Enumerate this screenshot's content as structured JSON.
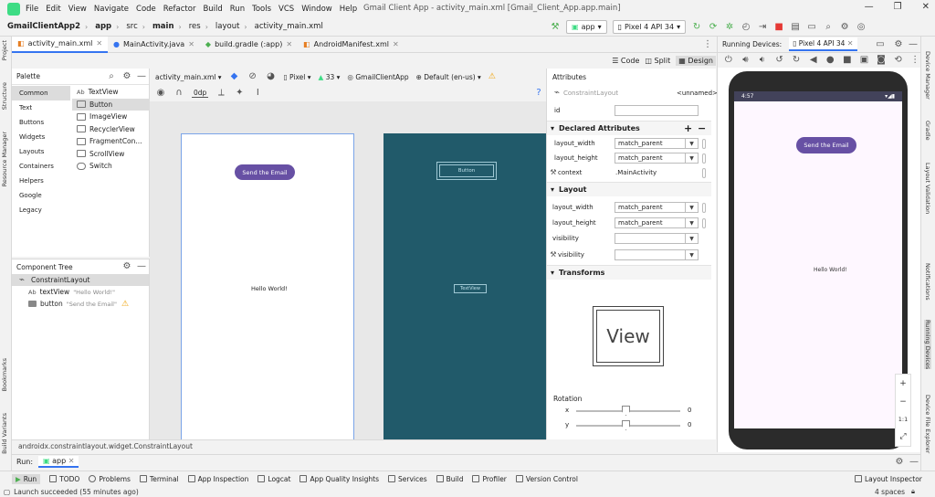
{
  "menu": {
    "items": [
      "File",
      "Edit",
      "View",
      "Navigate",
      "Code",
      "Refactor",
      "Build",
      "Run",
      "Tools",
      "VCS",
      "Window",
      "Help"
    ],
    "window_title": "Gmail Client App - activity_main.xml [Gmail_Client_App.app.main]"
  },
  "nav": {
    "breadcrumb": [
      "GmailClientApp2",
      "app",
      "src",
      "main",
      "res",
      "layout",
      "activity_main.xml"
    ],
    "run_config": "app",
    "device": "Pixel 4 API 34"
  },
  "editor_tabs": [
    {
      "label": "activity_main.xml",
      "active": true
    },
    {
      "label": "MainActivity.java",
      "active": false
    },
    {
      "label": "build.gradle (:app)",
      "active": false
    },
    {
      "label": "AndroidManifest.xml",
      "active": false
    }
  ],
  "view_modes": {
    "code": "Code",
    "split": "Split",
    "design": "Design"
  },
  "left_strip": [
    "Project",
    "Structure",
    "Resource Manager",
    "Bookmarks",
    "Build Variants"
  ],
  "right_strip": [
    "Device Manager",
    "Gradle",
    "Layout Validation",
    "Notifications",
    "Running Devices",
    "Device File Explorer"
  ],
  "palette": {
    "title": "Palette",
    "categories": [
      "Common",
      "Text",
      "Buttons",
      "Widgets",
      "Layouts",
      "Containers",
      "Helpers",
      "Google",
      "Legacy"
    ],
    "selected_category": "Common",
    "items": [
      "TextView",
      "Button",
      "ImageView",
      "RecyclerView",
      "FragmentCon...",
      "ScrollView",
      "Switch"
    ],
    "item_icons": [
      "Ab",
      "",
      "",
      "",
      "",
      "",
      ""
    ],
    "selected_item": "Button"
  },
  "component_tree": {
    "title": "Component Tree",
    "root": "ConstraintLayout",
    "children": [
      {
        "prefix": "Ab",
        "name": "textView",
        "value": "\"Hello World!\""
      },
      {
        "prefix": "",
        "name": "button",
        "value": "\"Send the Email\""
      }
    ]
  },
  "surface_toolbar": {
    "file": "activity_main.xml",
    "device": "Pixel",
    "api": "33",
    "theme": "GmailClientApp",
    "locale": "Default (en-us)",
    "margin": "0dp"
  },
  "design": {
    "button_text": "Send the Email",
    "hello_text": "Hello World!",
    "blueprint_button": "Button",
    "blueprint_text": "TextView"
  },
  "status_path": "androidx.constraintlayout.widget.ConstraintLayout",
  "attributes": {
    "title": "Attributes",
    "component": "ConstraintLayout",
    "unnamed": "<unnamed>",
    "id_label": "id",
    "declared_title": "Declared Attributes",
    "declared": [
      {
        "label": "layout_width",
        "value": "match_parent"
      },
      {
        "label": "layout_height",
        "value": "match_parent"
      },
      {
        "label": "context",
        "value": ".MainActivity"
      }
    ],
    "layout_title": "Layout",
    "layout": [
      {
        "label": "layout_width",
        "value": "match_parent"
      },
      {
        "label": "layout_height",
        "value": "match_parent"
      },
      {
        "label": "visibility",
        "value": ""
      },
      {
        "label": "visibility",
        "value": ""
      }
    ],
    "transforms_title": "Transforms",
    "view_preview": "View",
    "rotation_label": "Rotation",
    "rotation": [
      {
        "axis": "x",
        "value": "0"
      },
      {
        "axis": "y",
        "value": "0"
      }
    ]
  },
  "running_devices": {
    "title": "Running Devices:",
    "tab": "Pixel 4 API 34",
    "time": "4:57",
    "button_text": "Send the Email",
    "hello_text": "Hello World!",
    "zoom": [
      "+",
      "−",
      "1:1",
      "⤢"
    ]
  },
  "run": {
    "label": "Run:",
    "config": "app"
  },
  "tool_windows": [
    "Run",
    "TODO",
    "Problems",
    "Terminal",
    "App Inspection",
    "Logcat",
    "App Quality Insights",
    "Services",
    "Build",
    "Profiler",
    "Version Control"
  ],
  "layout_inspector": "Layout Inspector",
  "status": {
    "message": "Launch succeeded (55 minutes ago)",
    "position": "4 spaces"
  },
  "colors": {
    "primary": "#6750a4",
    "blueprint": "#215a6a",
    "selection": "#7aa4e8"
  }
}
